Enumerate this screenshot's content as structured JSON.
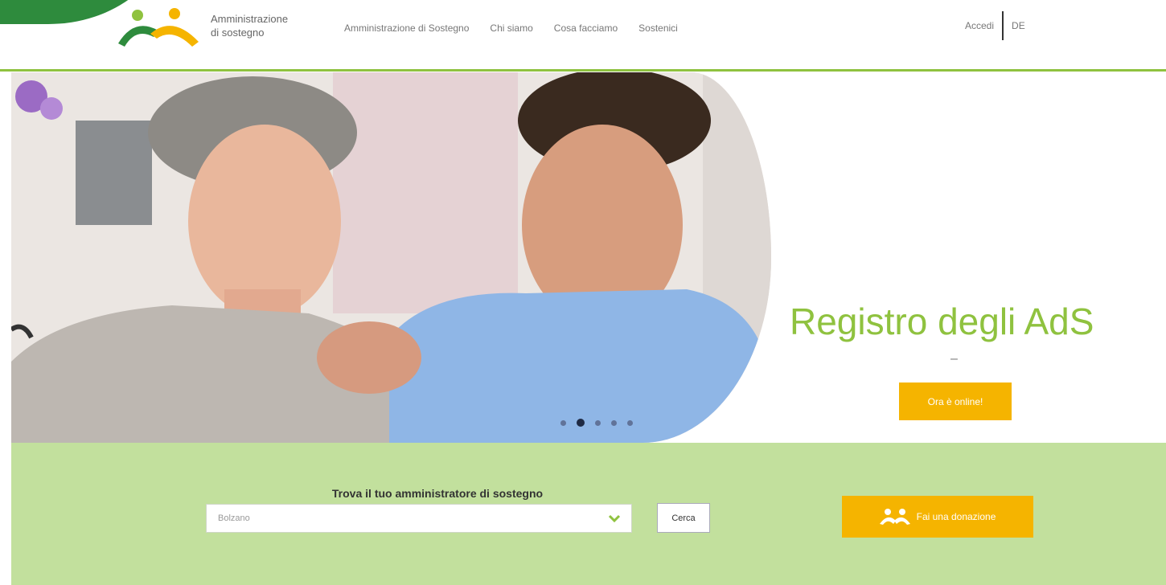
{
  "header": {
    "logo_line1": "Amministrazione",
    "logo_line2": "di sostegno",
    "nav": [
      {
        "label": "Amministrazione di Sostegno"
      },
      {
        "label": "Chi siamo"
      },
      {
        "label": "Cosa facciamo"
      },
      {
        "label": "Sostenici"
      }
    ],
    "login_label": "Accedi",
    "language_label": "DE"
  },
  "hero": {
    "title": "Registro degli AdS",
    "dash": "–",
    "cta_label": "Ora è online!",
    "slides": 5,
    "active_slide": 2
  },
  "search": {
    "title": "Trova il tuo amministratore di sostegno",
    "selected_value": "Bolzano",
    "button_label": "Cerca"
  },
  "donate": {
    "label": "Fai una donazione",
    "icon": "people-group-icon"
  },
  "colors": {
    "brand_green": "#8fc23f",
    "dark_green": "#2e8b3d",
    "accent_yellow": "#f5b400",
    "band_green": "#c2e09d"
  }
}
